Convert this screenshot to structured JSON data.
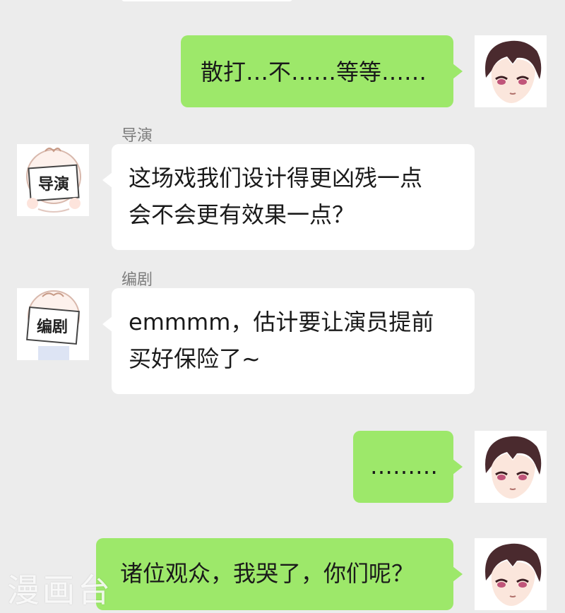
{
  "colors": {
    "background": "#ececec",
    "self_bubble": "#9de86a",
    "other_bubble": "#ffffff",
    "sender_name": "#7d7d7d"
  },
  "messages": [
    {
      "side": "right",
      "avatar": "boy-avatar-icon",
      "text": "散打…不……等等……"
    },
    {
      "side": "left",
      "sender": "导演",
      "avatar": "director-avatar-icon",
      "avatar_card": "导演",
      "line1": "这场戏我们设计得更凶残一点",
      "line2": "会不会更有效果一点？"
    },
    {
      "side": "left",
      "sender": "编剧",
      "avatar": "writer-avatar-icon",
      "avatar_card": "编剧",
      "line1": "emmmm，估计要让演员提前",
      "line2": "买好保险了~"
    },
    {
      "side": "right",
      "avatar": "boy-avatar-icon",
      "text": "………"
    },
    {
      "side": "right",
      "avatar": "boy-avatar-icon",
      "text": "诸位观众，我哭了，你们呢？"
    }
  ],
  "watermark": "漫画台"
}
